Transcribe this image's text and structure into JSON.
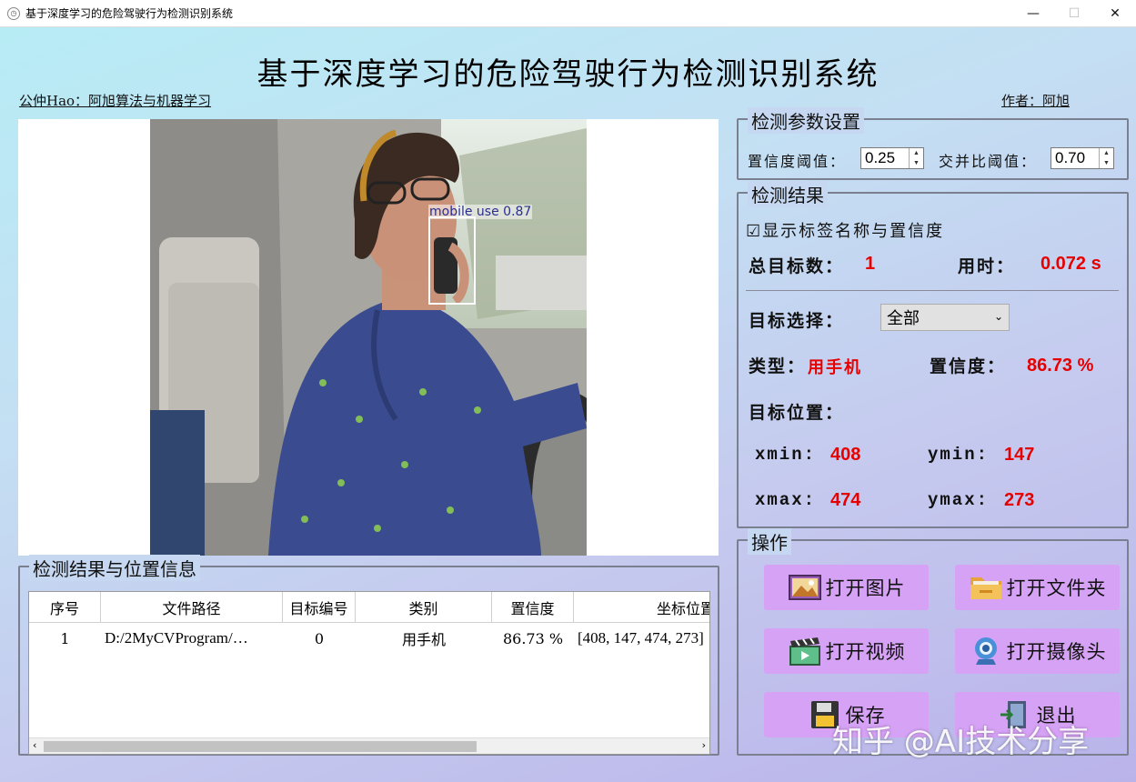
{
  "window": {
    "title": "基于深度学习的危险驾驶行为检测识别系统",
    "minimize": "—",
    "maximize": "☐",
    "close": "✕"
  },
  "header": {
    "title": "基于深度学习的危险驾驶行为检测识别系统",
    "left_link": "公仲Hao：阿旭算法与机器学习",
    "right_link": "作者：阿旭"
  },
  "image": {
    "detection_label": "mobile use 0.87"
  },
  "params": {
    "title": "检测参数设置",
    "conf_label": "置信度阈值：",
    "conf_value": "0.25",
    "iou_label": "交并比阈值：",
    "iou_value": "0.70"
  },
  "results": {
    "title": "检测结果",
    "show_label_checkbox": "显示标签名称与置信度",
    "total_label": "总目标数：",
    "total_value": "1",
    "time_label": "用时：",
    "time_value": "0.072 s",
    "target_select_label": "目标选择：",
    "target_select_value": "全部",
    "type_label": "类型：",
    "type_value": "用手机",
    "confidence_label": "置信度：",
    "confidence_value": "86.73 %",
    "position_label": "目标位置：",
    "xmin_label": "xmin:",
    "xmin_value": "408",
    "ymin_label": "ymin:",
    "ymin_value": "147",
    "xmax_label": "xmax:",
    "xmax_value": "474",
    "ymax_label": "ymax:",
    "ymax_value": "273"
  },
  "operations": {
    "title": "操作",
    "open_image": "打开图片",
    "open_folder": "打开文件夹",
    "open_video": "打开视频",
    "open_camera": "打开摄像头",
    "save": "保存",
    "exit": "退出"
  },
  "table": {
    "title": "检测结果与位置信息",
    "columns": [
      "序号",
      "文件路径",
      "目标编号",
      "类别",
      "置信度",
      "坐标位置"
    ],
    "rows": [
      [
        "1",
        "D:/2MyCVProgram/…",
        "0",
        "用手机",
        "86.73 %",
        "[408, 147, 474, 273]"
      ]
    ]
  },
  "watermark": "知乎 @AI技术分享"
}
